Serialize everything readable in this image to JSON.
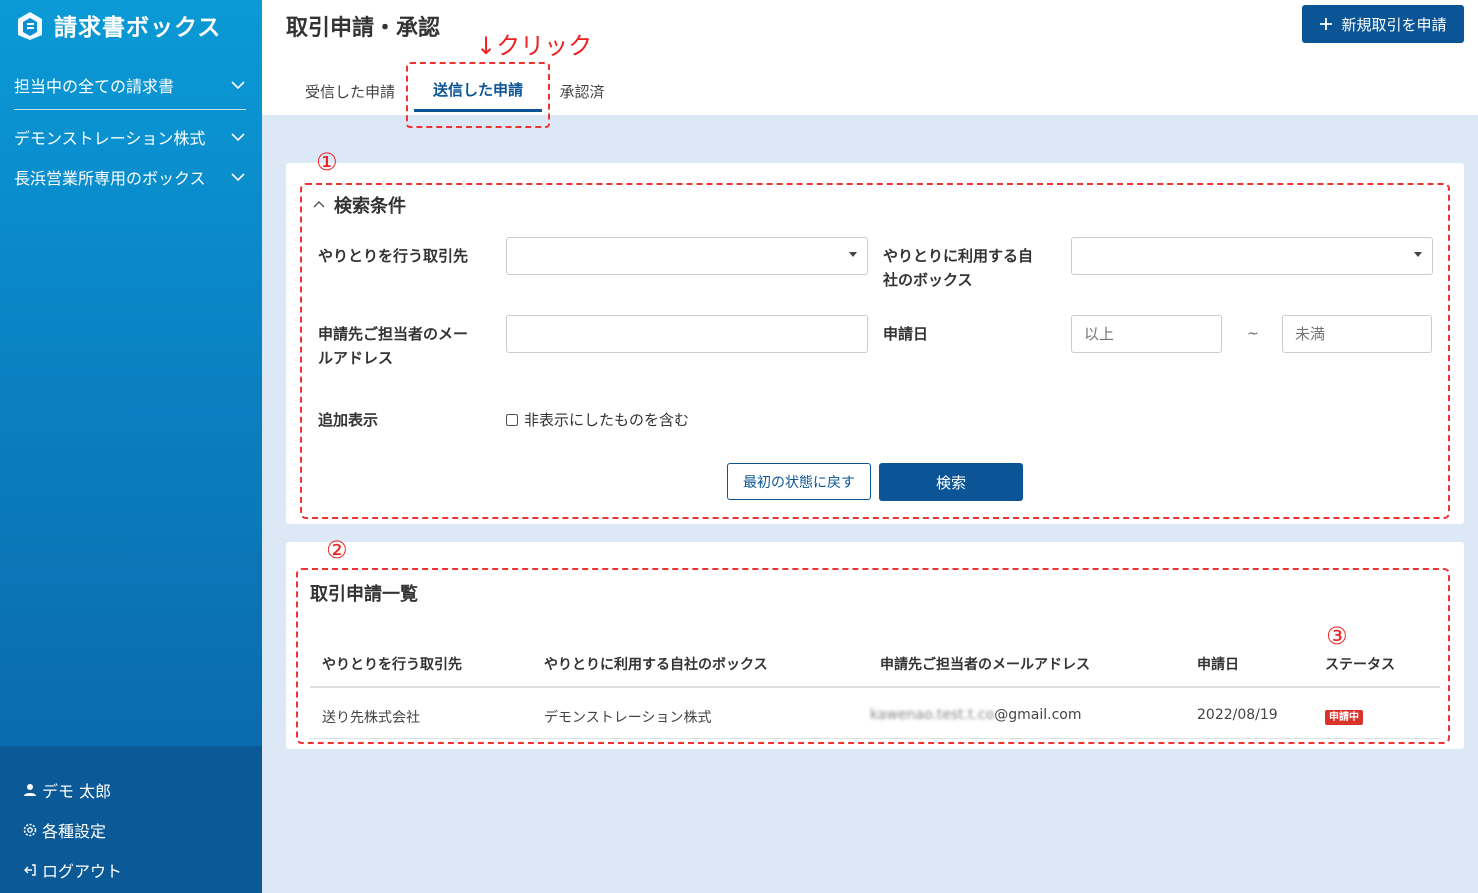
{
  "app": {
    "logo_text": "請求書ボックス",
    "sidebar_items": [
      {
        "label": "担当中の全ての請求書"
      },
      {
        "label": "デモンストレーション株式"
      },
      {
        "label": "長浜営業所専用のボックス"
      }
    ],
    "user_name": "デモ 太郎",
    "settings_label": "各種設定",
    "logout_label": "ログアウト"
  },
  "header": {
    "title": "取引申請・承認",
    "new_button": "新規取引を申請",
    "tabs": [
      "受信した申請",
      "送信した申請",
      "承認済"
    ],
    "active_tab": "送信した申請",
    "annotation": "↓クリック"
  },
  "search": {
    "marker": "①",
    "title": "検索条件",
    "partner_label": "やりとりを行う取引先",
    "box_label": "やりとりに利用する自社のボックス",
    "box_label_line1": "やりとりに利用する自",
    "box_label_line2": "社のボックス",
    "email_label_line1": "申請先ご担当者のメー",
    "email_label_line2": "ルアドレス",
    "date_label": "申請日",
    "date_from_placeholder": "以上",
    "date_to_placeholder": "未満",
    "date_separator": "~",
    "extra_label": "追加表示",
    "include_hidden": "非表示にしたものを含む",
    "reset_button": "最初の状態に戻す",
    "search_button": "検索"
  },
  "list": {
    "marker": "②",
    "status_marker": "③",
    "title": "取引申請一覧",
    "columns": [
      "やりとりを行う取引先",
      "やりとりに利用する自社のボックス",
      "申請先ご担当者のメールアドレス",
      "申請日",
      "ステータス"
    ],
    "rows": [
      {
        "partner": "送り先株式会社",
        "box": "デモンストレーション株式",
        "email_masked": "kawenao.test.t.co",
        "email_domain": "@gmail.com",
        "date": "2022/08/19",
        "status": "申請中"
      }
    ]
  },
  "colors": {
    "primary": "#0b5596",
    "sidebar_top": "#0a9ad6",
    "annotation": "#e22",
    "status_badge": "#d9342b"
  }
}
